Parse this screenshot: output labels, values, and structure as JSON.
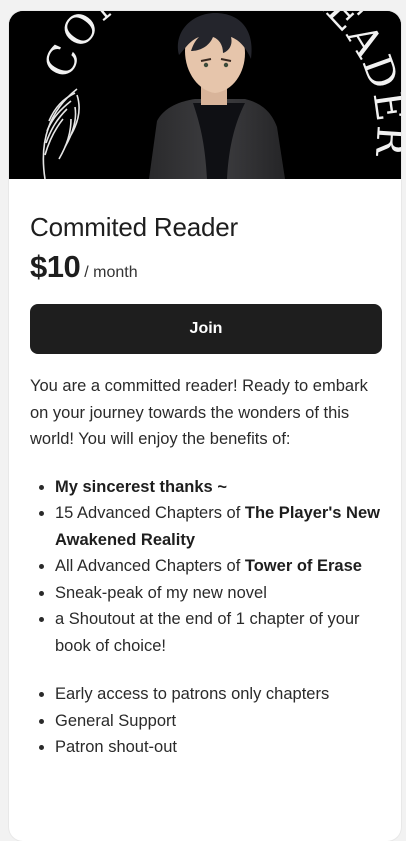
{
  "banner": {
    "arc_text": "COMMITED READER",
    "image_description": "anime-style dark-haired man in black turtleneck and grey coat with white feather on black background"
  },
  "tier": {
    "title": "Commited Reader",
    "price": "$10",
    "period": "/ month",
    "join_label": "Join",
    "description": "You are a committed reader! Ready to embark on your journey towards the wonders of this world! You will enjoy the benefits of:"
  },
  "benefits": [
    {
      "text": "",
      "bold": "My sincerest thanks ~",
      "after": ""
    },
    {
      "text": "15 Advanced Chapters of ",
      "bold": "The Player's New Awakened Reality",
      "after": ""
    },
    {
      "text": "All Advanced Chapters of ",
      "bold": "Tower of Erase",
      "after": ""
    },
    {
      "text": "Sneak-peak of my new novel",
      "bold": "",
      "after": ""
    },
    {
      "text": "a Shoutout at the end of 1 chapter of your book of choice!",
      "bold": "",
      "after": ""
    }
  ],
  "extra_benefits": [
    "Early access to patrons only chapters",
    "General Support",
    "Patron shout-out"
  ],
  "colors": {
    "button_bg": "#1e1e1e",
    "button_text": "#ffffff",
    "page_bg": "#f2f2f2",
    "card_bg": "#ffffff"
  }
}
